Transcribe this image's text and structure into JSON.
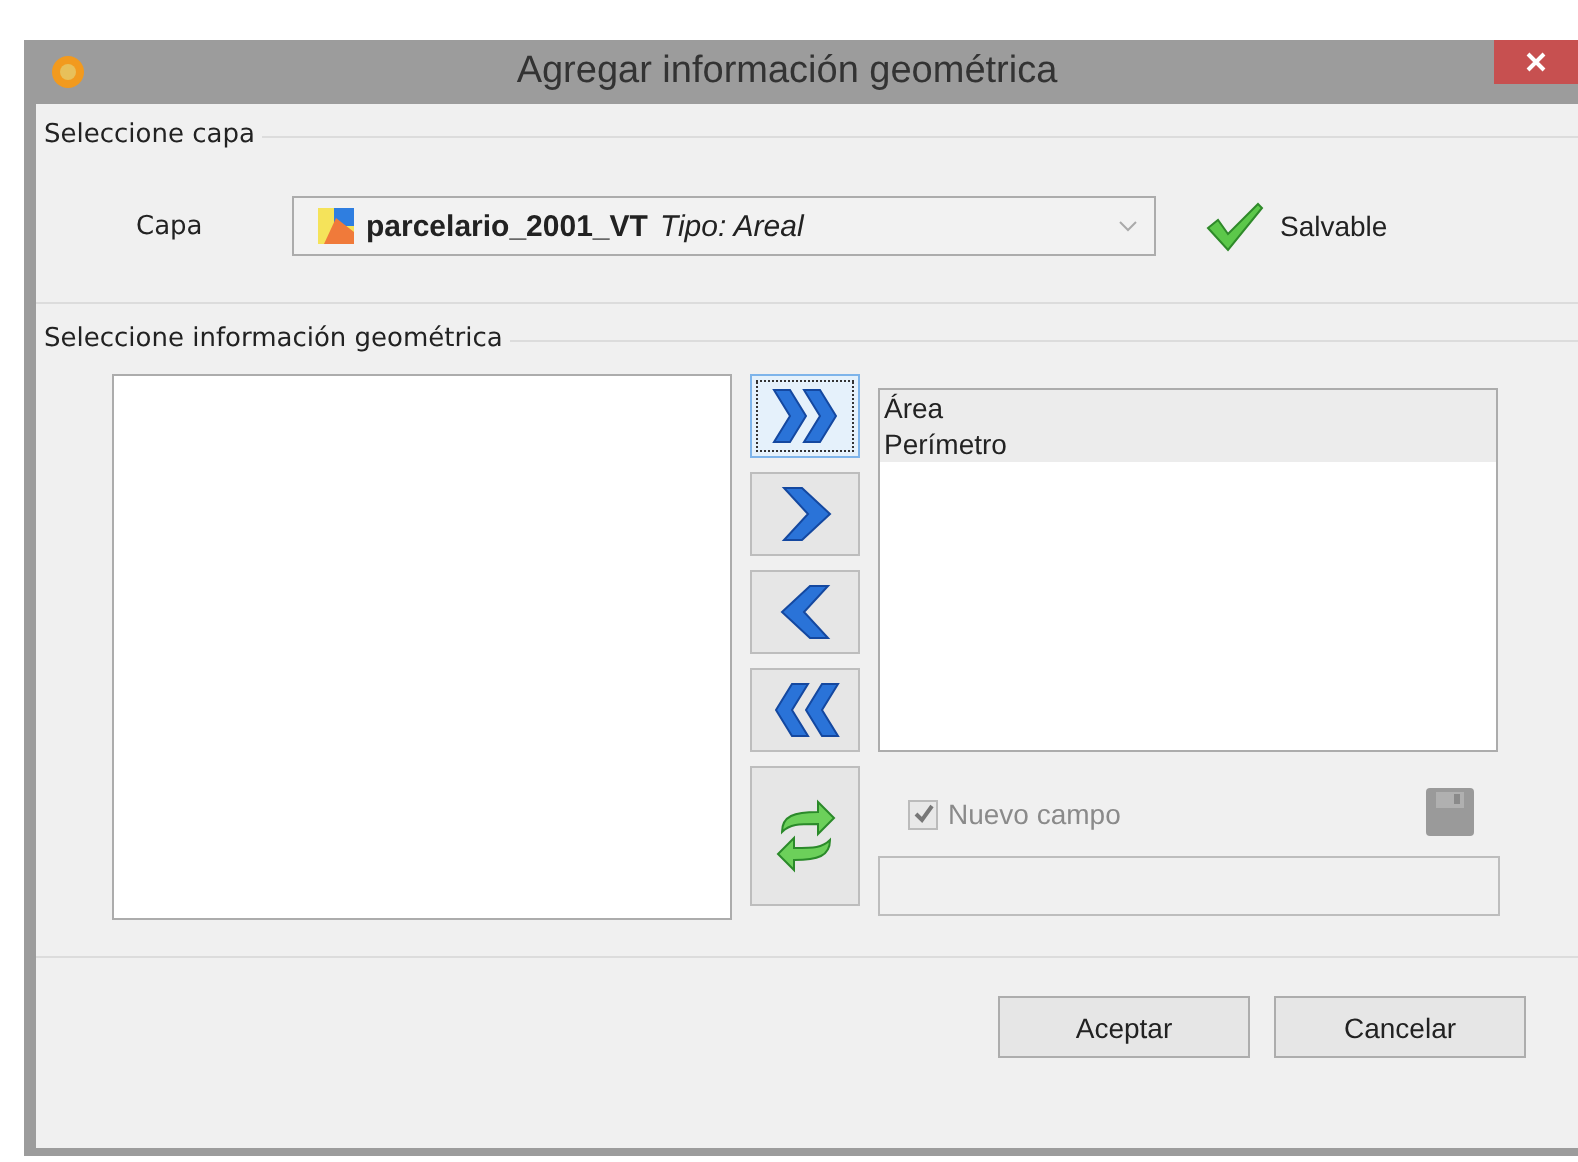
{
  "window": {
    "title": "Agregar información geométrica"
  },
  "layer_section": {
    "title": "Seleccione capa",
    "label": "Capa",
    "layer_name": "parcelario_2001_VT",
    "layer_type": "Tipo: Areal",
    "status": "Salvable"
  },
  "geometry_section": {
    "title": "Seleccione información geométrica",
    "selected_items": [
      {
        "label": "Área",
        "selected": true
      },
      {
        "label": "Perímetro",
        "selected": true
      }
    ],
    "new_field": {
      "label": "Nuevo campo",
      "checked": true,
      "disabled": true
    }
  },
  "buttons": [
    "Aceptar",
    "Cancelar"
  ]
}
